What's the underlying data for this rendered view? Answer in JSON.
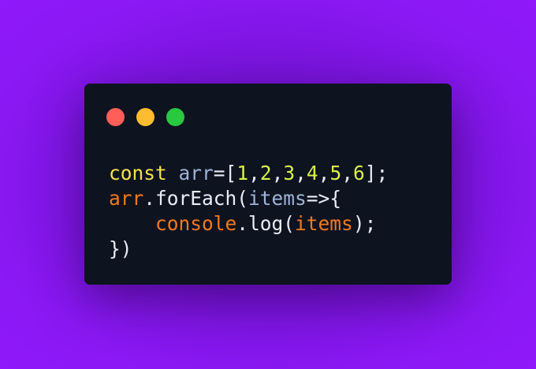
{
  "window": {
    "controls": [
      {
        "name": "close",
        "color": "#ff5f57"
      },
      {
        "name": "minimize",
        "color": "#febc2e"
      },
      {
        "name": "maximize",
        "color": "#28c840"
      }
    ]
  },
  "colors": {
    "background": "#8a18f4",
    "editor": "#0e1320",
    "keyword": "#f4e04d",
    "variable": "#9fb3d6",
    "number": "#d9f24b",
    "punctuation": "#e8ecf4",
    "identifier": "#f07a1f"
  },
  "code": {
    "lines": [
      [
        {
          "text": "const",
          "type": "keyword"
        },
        {
          "text": " ",
          "type": "punctuation"
        },
        {
          "text": "arr",
          "type": "variable"
        },
        {
          "text": "=[",
          "type": "punctuation"
        },
        {
          "text": "1",
          "type": "number"
        },
        {
          "text": ",",
          "type": "punctuation"
        },
        {
          "text": "2",
          "type": "number"
        },
        {
          "text": ",",
          "type": "punctuation"
        },
        {
          "text": "3",
          "type": "number"
        },
        {
          "text": ",",
          "type": "punctuation"
        },
        {
          "text": "4",
          "type": "number"
        },
        {
          "text": ",",
          "type": "punctuation"
        },
        {
          "text": "5",
          "type": "number"
        },
        {
          "text": ",",
          "type": "punctuation"
        },
        {
          "text": "6",
          "type": "number"
        },
        {
          "text": "];",
          "type": "punctuation"
        }
      ],
      [
        {
          "text": "arr",
          "type": "identifier"
        },
        {
          "text": ".forEach(",
          "type": "punctuation"
        },
        {
          "text": "items",
          "type": "variable"
        },
        {
          "text": "=>{",
          "type": "punctuation"
        }
      ],
      [
        {
          "text": "    ",
          "type": "punctuation"
        },
        {
          "text": "console",
          "type": "identifier"
        },
        {
          "text": ".log(",
          "type": "punctuation"
        },
        {
          "text": "items",
          "type": "identifier"
        },
        {
          "text": ");",
          "type": "punctuation"
        }
      ],
      [
        {
          "text": "})",
          "type": "punctuation"
        }
      ]
    ]
  }
}
